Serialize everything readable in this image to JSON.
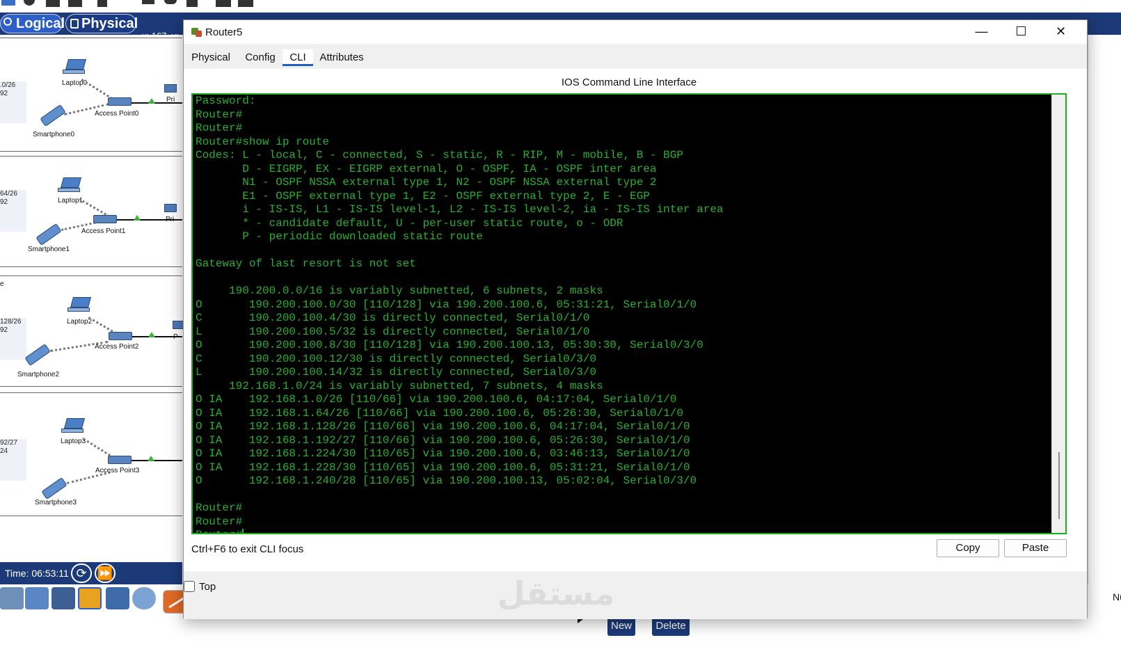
{
  "packet_tracer": {
    "mode_logical": "Logical",
    "mode_physical": "Physical",
    "coords": "x: 167, y:",
    "time_label": "Time: 06:53:11",
    "clusters": [
      {
        "info_line1": ".0/26",
        "info_line2": "92",
        "laptop": "Laptop0",
        "access_point": "Access Point0",
        "smartphone": "Smartphone0",
        "edge": "Pri"
      },
      {
        "info_line1": "64/26",
        "info_line2": "92",
        "laptop": "Laptop1",
        "access_point": "Access Point1",
        "smartphone": "Smartphone1",
        "edge": "Pri"
      },
      {
        "info_line1": "128/26",
        "info_line2": "92",
        "laptop": "Laptop2",
        "access_point": "Access Point2",
        "smartphone": "Smartphone2",
        "edge": "P"
      },
      {
        "info_line1": "92/27",
        "info_line2": "24",
        "laptop": "Laptop3",
        "access_point": "Access Point3",
        "smartphone": "Smartphone3",
        "edge": ""
      }
    ],
    "cluster3_prefix": "e",
    "new_button": "New",
    "delete_button": "Delete",
    "right_cut_text": "Nu"
  },
  "window": {
    "title": "Router5",
    "minimize": "—",
    "maximize": "☐",
    "close": "✕",
    "tabs": [
      "Physical",
      "Config",
      "CLI",
      "Attributes"
    ],
    "active_tab": "CLI",
    "cli_header": "IOS Command Line Interface",
    "cli_lines": [
      "Password:",
      "Router#",
      "Router#",
      "Router#show ip route",
      "Codes: L - local, C - connected, S - static, R - RIP, M - mobile, B - BGP",
      "       D - EIGRP, EX - EIGRP external, O - OSPF, IA - OSPF inter area",
      "       N1 - OSPF NSSA external type 1, N2 - OSPF NSSA external type 2",
      "       E1 - OSPF external type 1, E2 - OSPF external type 2, E - EGP",
      "       i - IS-IS, L1 - IS-IS level-1, L2 - IS-IS level-2, ia - IS-IS inter area",
      "       * - candidate default, U - per-user static route, o - ODR",
      "       P - periodic downloaded static route",
      "",
      "Gateway of last resort is not set",
      "",
      "     190.200.0.0/16 is variably subnetted, 6 subnets, 2 masks",
      "O       190.200.100.0/30 [110/128] via 190.200.100.6, 05:31:21, Serial0/1/0",
      "C       190.200.100.4/30 is directly connected, Serial0/1/0",
      "L       190.200.100.5/32 is directly connected, Serial0/1/0",
      "O       190.200.100.8/30 [110/128] via 190.200.100.13, 05:30:30, Serial0/3/0",
      "C       190.200.100.12/30 is directly connected, Serial0/3/0",
      "L       190.200.100.14/32 is directly connected, Serial0/3/0",
      "     192.168.1.0/24 is variably subnetted, 7 subnets, 4 masks",
      "O IA    192.168.1.0/26 [110/66] via 190.200.100.6, 04:17:04, Serial0/1/0",
      "O IA    192.168.1.64/26 [110/66] via 190.200.100.6, 05:26:30, Serial0/1/0",
      "O IA    192.168.1.128/26 [110/66] via 190.200.100.6, 04:17:04, Serial0/1/0",
      "O IA    192.168.1.192/27 [110/66] via 190.200.100.6, 05:26:30, Serial0/1/0",
      "O IA    192.168.1.224/30 [110/65] via 190.200.100.6, 03:46:13, Serial0/1/0",
      "O IA    192.168.1.228/30 [110/65] via 190.200.100.6, 05:31:21, Serial0/1/0",
      "O       192.168.1.240/28 [110/65] via 190.200.100.13, 05:02:04, Serial0/3/0",
      "",
      "Router#",
      "Router#",
      "Router#"
    ],
    "hint": "Ctrl+F6 to exit CLI focus",
    "copy_button": "Copy",
    "paste_button": "Paste",
    "top_checkbox_label": "Top",
    "top_checked": false,
    "watermark_text": "مستقل"
  },
  "colors": {
    "terminal_bg": "#000000",
    "terminal_fg": "#27b02f",
    "terminal_border": "#1bb01b",
    "pt_blue": "#1c3a78",
    "tab_accent": "#1f5fbf"
  }
}
